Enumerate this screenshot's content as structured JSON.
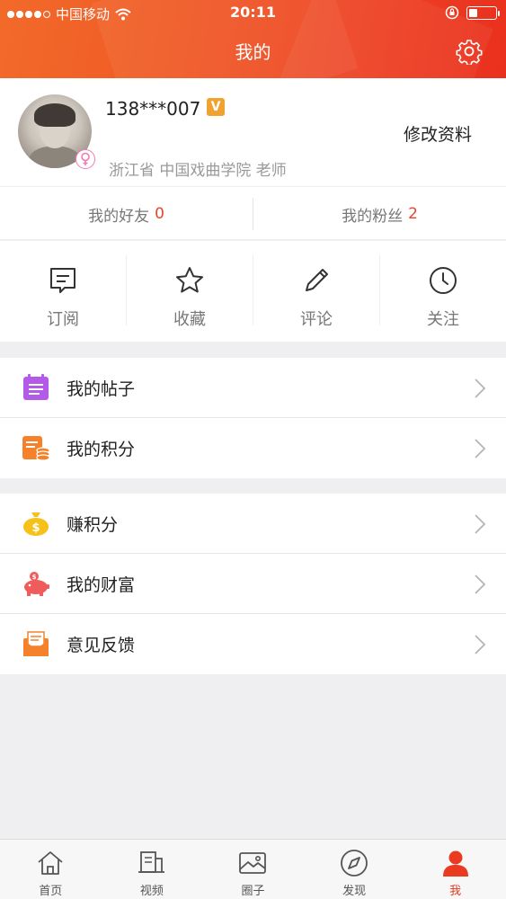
{
  "status_bar": {
    "carrier": "中国移动",
    "time": "20:11",
    "battery_level": 0.35
  },
  "header": {
    "title": "我的",
    "settings_icon": "gear-icon"
  },
  "profile": {
    "username": "138***007",
    "verified_badge": "V",
    "edit_label": "修改资料",
    "info": "浙江省 中国戏曲学院 老师",
    "gender_icon": "female-icon"
  },
  "stats": {
    "friends_label": "我的好友",
    "friends_count": "0",
    "fans_label": "我的粉丝",
    "fans_count": "2"
  },
  "actions": [
    {
      "label": "订阅",
      "icon": "subscribe-icon"
    },
    {
      "label": "收藏",
      "icon": "star-icon"
    },
    {
      "label": "评论",
      "icon": "pencil-icon"
    },
    {
      "label": "关注",
      "icon": "clock-icon"
    }
  ],
  "menu_group_1": [
    {
      "label": "我的帖子",
      "icon": "posts-icon",
      "color": "#b35be8"
    },
    {
      "label": "我的积分",
      "icon": "points-icon",
      "color": "#f5822a"
    }
  ],
  "menu_group_2": [
    {
      "label": "赚积分",
      "icon": "moneybag-icon",
      "color": "#f5c11a"
    },
    {
      "label": "我的财富",
      "icon": "piggybank-icon",
      "color": "#f05b5b"
    },
    {
      "label": "意见反馈",
      "icon": "feedback-icon",
      "color": "#f5822a"
    }
  ],
  "tabbar": [
    {
      "label": "首页",
      "icon": "home-icon"
    },
    {
      "label": "视频",
      "icon": "video-icon"
    },
    {
      "label": "圈子",
      "icon": "image-icon"
    },
    {
      "label": "发现",
      "icon": "compass-icon"
    },
    {
      "label": "我",
      "icon": "person-icon"
    }
  ],
  "colors": {
    "accent": "#ea3a1f",
    "header_start": "#f26a2a",
    "header_end": "#e9301e",
    "count": "#e8452a"
  }
}
